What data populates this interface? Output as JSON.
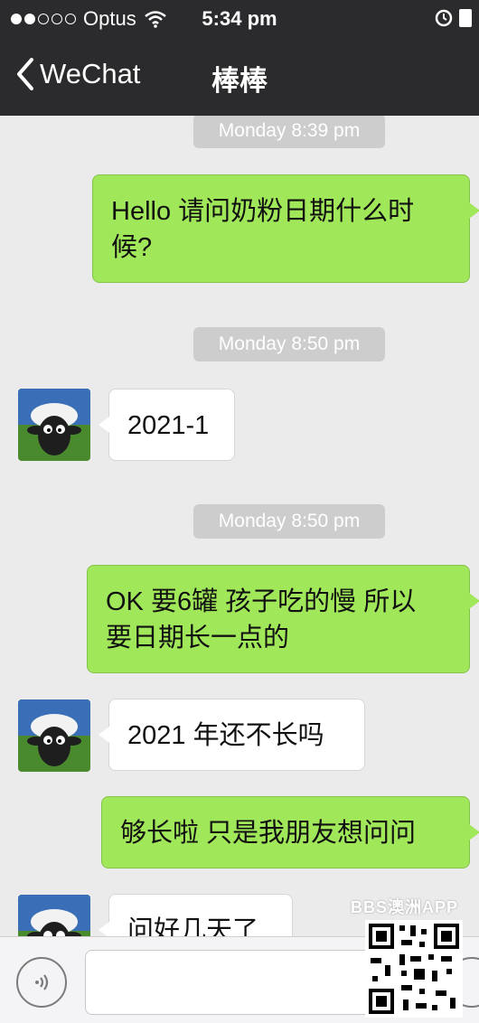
{
  "status_bar": {
    "carrier": "Optus",
    "time": "5:34 pm"
  },
  "nav": {
    "back_label": "WeChat",
    "title": "棒棒"
  },
  "messages": [
    {
      "type": "timestamp",
      "text": "Monday 8:39 pm"
    },
    {
      "type": "outgoing",
      "lines": [
        "Hello 请问奶粉日期什么时",
        "候?"
      ]
    },
    {
      "type": "timestamp",
      "text": "Monday 8:50 pm"
    },
    {
      "type": "incoming",
      "text": "2021-1"
    },
    {
      "type": "timestamp",
      "text": "Monday 8:50 pm"
    },
    {
      "type": "outgoing",
      "lines": [
        "OK 要6罐 孩子吃的慢 所以",
        "要日期长一点的"
      ]
    },
    {
      "type": "incoming",
      "text": "2021 年还不长吗"
    },
    {
      "type": "outgoing",
      "text": "够长啦 只是我朋友想问问"
    },
    {
      "type": "incoming",
      "text": "问好几天了"
    }
  ],
  "input": {
    "value": "",
    "placeholder": ""
  },
  "watermark": "BBS澳洲APP",
  "colors": {
    "header": "#2b2b2d",
    "outgoing_bubble": "#a0e75a",
    "incoming_bubble": "#ffffff",
    "background": "#ebebeb"
  },
  "icons": [
    "back-chevron-icon",
    "wifi-icon",
    "alarm-icon",
    "battery-icon",
    "voice-icon",
    "emoji-icon",
    "avatar-sheep"
  ]
}
